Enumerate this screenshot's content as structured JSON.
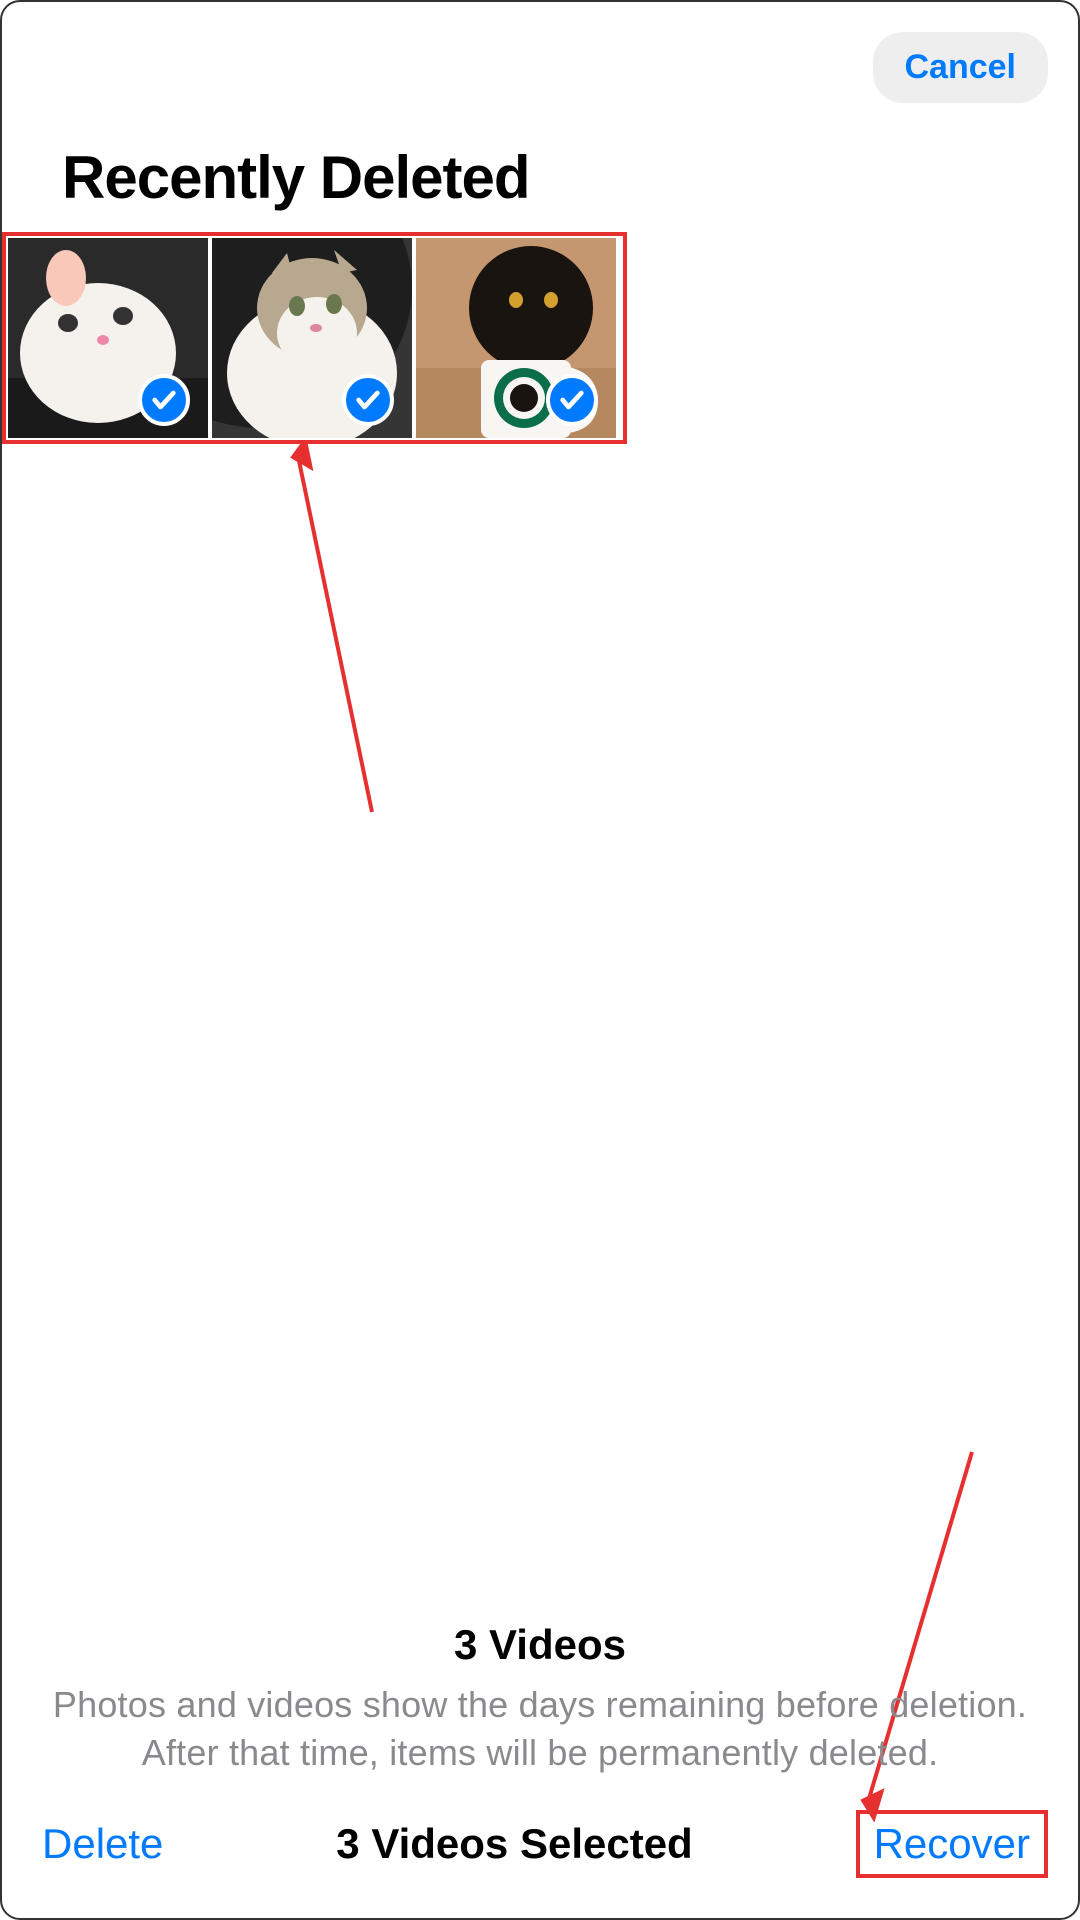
{
  "header": {
    "cancel_label": "Cancel"
  },
  "page": {
    "title": "Recently Deleted"
  },
  "thumbnails": [
    {
      "alt": "white cat",
      "selected": true
    },
    {
      "alt": "tabby cat",
      "selected": true
    },
    {
      "alt": "black cat with mug",
      "selected": true
    }
  ],
  "info": {
    "count_label": "3 Videos",
    "description": "Photos and videos show the days remaining before deletion. After that time, items will be permanently deleted."
  },
  "footer": {
    "delete_label": "Delete",
    "status_label": "3 Videos Selected",
    "recover_label": "Recover"
  },
  "annotations": {
    "highlight_color": "#e63030"
  }
}
